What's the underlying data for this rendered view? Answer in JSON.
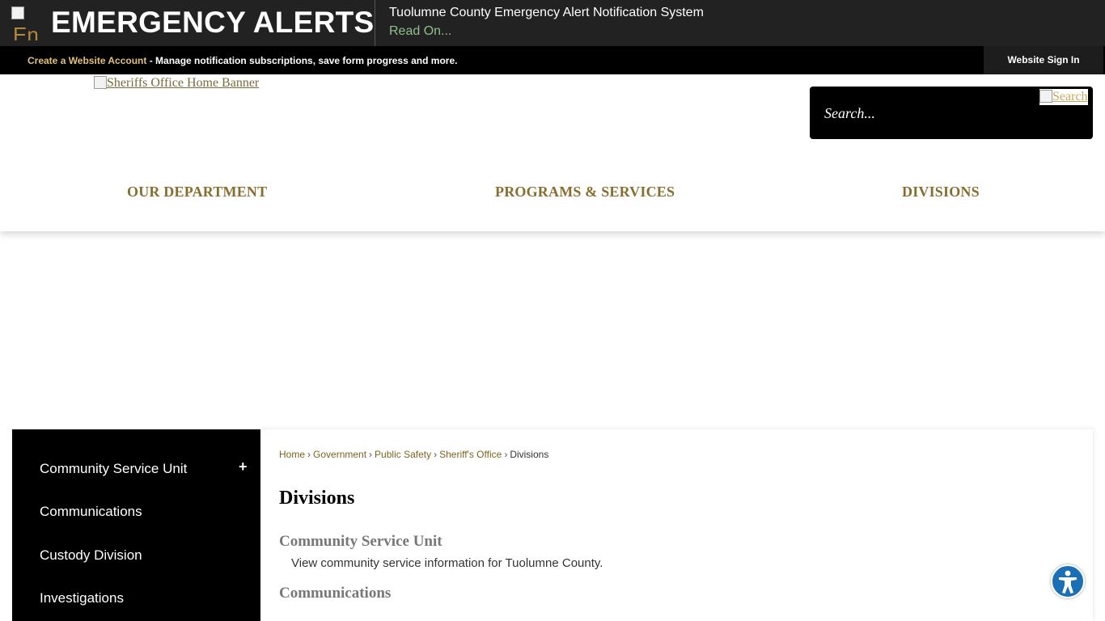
{
  "alert": {
    "logo_alt": "En",
    "title": "EMERGENCY ALERTS",
    "message": "Tuolumne County Emergency Alert Notification System",
    "read_on": "Read On..."
  },
  "account_bar": {
    "create_link": "Create a Website Account",
    "description": " - Manage notification subscriptions, save form progress and more.",
    "sign_in": "Website Sign In"
  },
  "header": {
    "banner_alt": "Sheriffs Office Home Banner",
    "search_placeholder": "Search...",
    "search_button": "Search"
  },
  "nav": {
    "items": [
      {
        "label": "OUR DEPARTMENT"
      },
      {
        "label": "PROGRAMS & SERVICES"
      },
      {
        "label": "DIVISIONS"
      }
    ]
  },
  "sidebar": {
    "expand_symbol": "+",
    "items": [
      {
        "label": "Community Service Unit"
      },
      {
        "label": "Communications"
      },
      {
        "label": "Custody Division"
      },
      {
        "label": "Investigations"
      }
    ]
  },
  "breadcrumb": {
    "items": [
      {
        "label": "Home"
      },
      {
        "label": "Government"
      },
      {
        "label": "Public Safety"
      },
      {
        "label": "Sheriff's Office"
      }
    ],
    "separator": "›",
    "current": "Divisions"
  },
  "content": {
    "title": "Divisions",
    "sections": [
      {
        "title": "Community Service Unit",
        "description": "View community service information for Tuolumne County."
      },
      {
        "title": "Communications"
      }
    ]
  },
  "colors": {
    "nav_gold": "#8a6d2e",
    "create_link": "#e0c277",
    "breadcrumb_link": "#7a6520",
    "accessibility_blue": "#1b6fb5"
  }
}
